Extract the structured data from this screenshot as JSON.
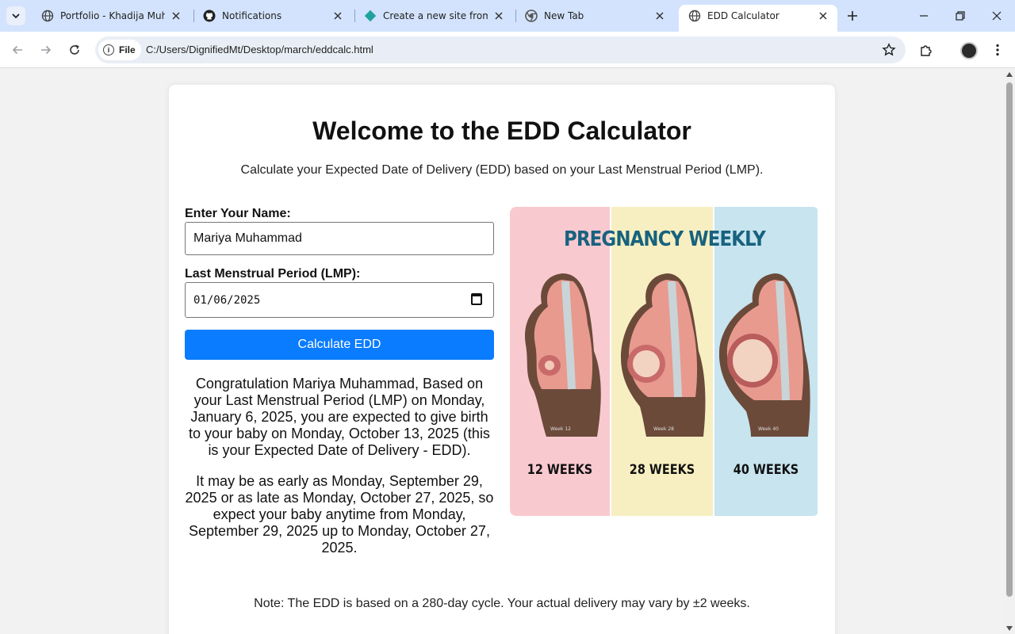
{
  "browser": {
    "tabs": [
      {
        "title": "Portfolio - Khadija Muhammad",
        "icon": "globe-icon"
      },
      {
        "title": "Notifications",
        "icon": "github-icon"
      },
      {
        "title": "Create a new site from git",
        "icon": "netlify-icon"
      },
      {
        "title": "New Tab",
        "icon": "chrome-icon"
      },
      {
        "title": "EDD Calculator",
        "icon": "globe-icon",
        "active": true
      }
    ],
    "address": {
      "scheme_label": "File",
      "url": "C:/Users/DignifiedMt/Desktop/march/eddcalc.html"
    }
  },
  "page": {
    "heading": "Welcome to the EDD Calculator",
    "subtitle": "Calculate your Expected Date of Delivery (EDD) based on your Last Menstrual Period (LMP).",
    "form": {
      "name_label": "Enter Your Name:",
      "name_value": "Mariya Muhammad",
      "lmp_label": "Last Menstrual Period (LMP):",
      "lmp_value": "01/06/2025",
      "button_label": "Calculate EDD"
    },
    "result": {
      "paragraph1": "Congratulation Mariya Muhammad, Based on your Last Menstrual Period (LMP) on Monday, January 6, 2025, you are expected to give birth to your baby on Monday, October 13, 2025 (this is your Expected Date of Delivery - EDD).",
      "paragraph2": "It may be as early as Monday, September 29, 2025 or as late as Monday, October 27, 2025, so expect your baby anytime from Monday, September 29, 2025 up to Monday, October 27, 2025."
    },
    "figure": {
      "title": "PREGNANCY WEEKLY",
      "panels": [
        {
          "label": "12 WEEKS",
          "caption": "Week 12",
          "color": "#f9c9d0"
        },
        {
          "label": "28 WEEKS",
          "caption": "Week 28",
          "color": "#f7efc1"
        },
        {
          "label": "40 WEEKS",
          "caption": "Week 40",
          "color": "#c7e4ef"
        }
      ]
    },
    "note": "Note: The EDD is based on a 280-day cycle. Your actual delivery may vary by ±2 weeks."
  },
  "colors": {
    "button": "#0a7cff",
    "tabstrip": "#d3e3fd",
    "title_teal": "#17627e"
  }
}
